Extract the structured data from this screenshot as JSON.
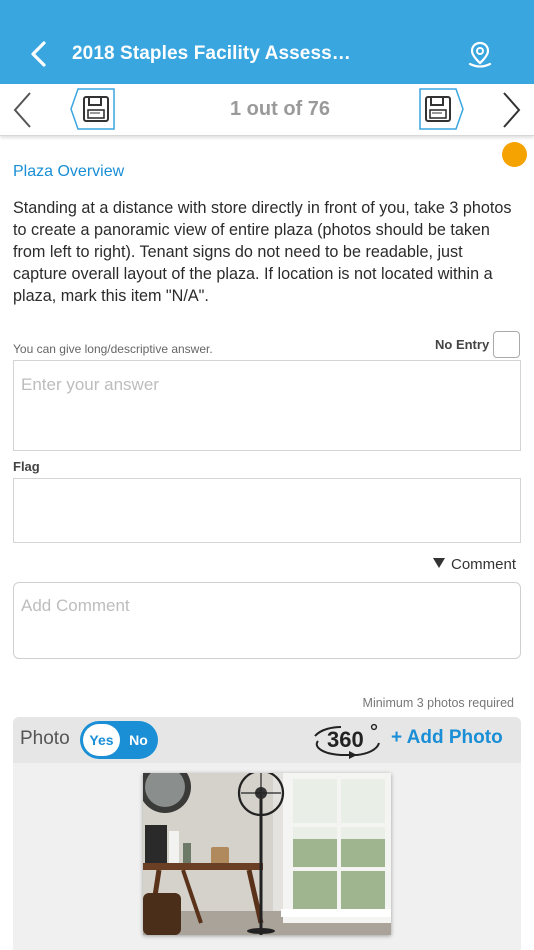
{
  "header": {
    "title": "2018 Staples Facility Assess…",
    "back_icon": "chevron-left-icon",
    "map_icon": "map-pin-icon",
    "bg_color": "#3aa6e0"
  },
  "navigation": {
    "counter": "1 out of 76",
    "prev_icon": "chevron-left-icon",
    "next_icon": "chevron-right-icon",
    "save_icon": "floppy-disk-icon"
  },
  "status": {
    "color": "#f5a300"
  },
  "question": {
    "section": "Plaza Overview",
    "text": "Standing at a distance with store directly in front of you, take 3 photos to create a panoramic view of entire plaza (photos should be taken from left to right). Tenant signs do not need to be readable, just capture overall layout of the plaza. If location is not located within a plaza, mark this item \"N/A\"."
  },
  "answer": {
    "hint": "You can give long/descriptive answer.",
    "no_entry_label": "No Entry",
    "no_entry_checked": false,
    "placeholder": "Enter your answer",
    "value": ""
  },
  "flag": {
    "label": "Flag",
    "value": ""
  },
  "comment": {
    "toggle_label": "Comment",
    "placeholder": "Add Comment",
    "value": ""
  },
  "photos": {
    "requirement": "Minimum 3 photos required",
    "label": "Photo",
    "toggle_yes": "Yes",
    "toggle_no": "No",
    "selected": "Yes",
    "icon_360_label": "360",
    "add_label": "+ Add Photo",
    "accent_color": "#1a8fd6"
  }
}
